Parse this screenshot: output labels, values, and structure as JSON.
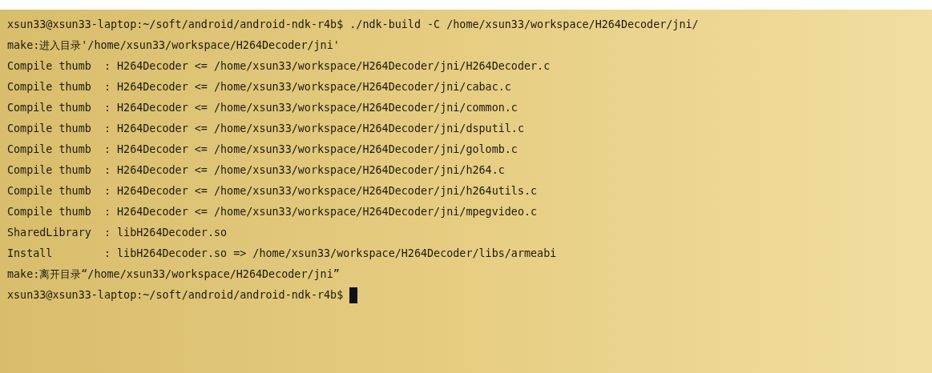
{
  "terminal": {
    "lines": [
      {
        "kind": "command",
        "text": "xsun33@xsun33-laptop:~/soft/android/android-ndk-r4b$ ./ndk-build -C /home/xsun33/workspace/H264Decoder/jni/"
      },
      {
        "kind": "output",
        "text": "make:进入目录'/home/xsun33/workspace/H264Decoder/jni'"
      },
      {
        "kind": "output",
        "text": "Compile thumb  : H264Decoder <= /home/xsun33/workspace/H264Decoder/jni/H264Decoder.c"
      },
      {
        "kind": "output",
        "text": "Compile thumb  : H264Decoder <= /home/xsun33/workspace/H264Decoder/jni/cabac.c"
      },
      {
        "kind": "output",
        "text": "Compile thumb  : H264Decoder <= /home/xsun33/workspace/H264Decoder/jni/common.c"
      },
      {
        "kind": "output",
        "text": "Compile thumb  : H264Decoder <= /home/xsun33/workspace/H264Decoder/jni/dsputil.c"
      },
      {
        "kind": "output",
        "text": "Compile thumb  : H264Decoder <= /home/xsun33/workspace/H264Decoder/jni/golomb.c"
      },
      {
        "kind": "output",
        "text": "Compile thumb  : H264Decoder <= /home/xsun33/workspace/H264Decoder/jni/h264.c"
      },
      {
        "kind": "output",
        "text": "Compile thumb  : H264Decoder <= /home/xsun33/workspace/H264Decoder/jni/h264utils.c"
      },
      {
        "kind": "output",
        "text": "Compile thumb  : H264Decoder <= /home/xsun33/workspace/H264Decoder/jni/mpegvideo.c"
      },
      {
        "kind": "output",
        "text": "SharedLibrary  : libH264Decoder.so"
      },
      {
        "kind": "output",
        "text": "Install        : libH264Decoder.so => /home/xsun33/workspace/H264Decoder/libs/armeabi"
      },
      {
        "kind": "output",
        "text": "make:离开目录“/home/xsun33/workspace/H264Decoder/jni”"
      },
      {
        "kind": "prompt",
        "text": "xsun33@xsun33-laptop:~/soft/android/android-ndk-r4b$ "
      }
    ]
  }
}
